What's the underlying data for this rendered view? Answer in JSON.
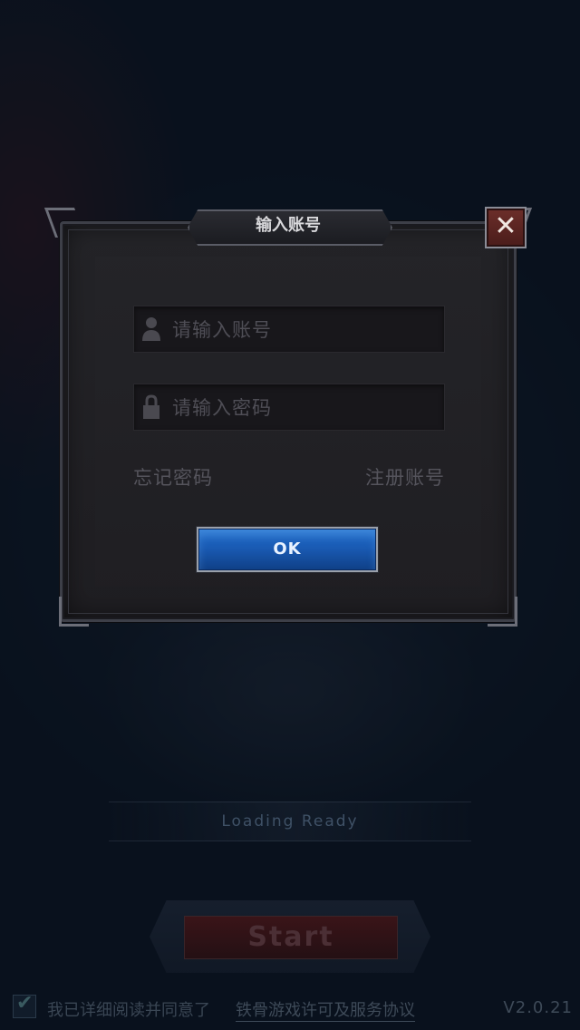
{
  "dialog": {
    "title": "输入账号",
    "close_icon": "✕",
    "account_placeholder": "请输入账号",
    "password_placeholder": "请输入密码",
    "forgot_password": "忘记密码",
    "register_account": "注册账号",
    "ok_button": "OK"
  },
  "background": {
    "loading_status": "Loading Ready",
    "start_button": "Start",
    "agreement_text": "我已详细阅读并同意了",
    "agreement_link": "铁骨游戏许可及服务协议",
    "checkmark": "✔",
    "version": "V2.0.21"
  },
  "colors": {
    "ok_button": "#1a5bb4",
    "close_button": "#5a2420",
    "background": "#0d1826"
  },
  "icons": {
    "user": "user-icon",
    "lock": "lock-icon",
    "close": "close-icon",
    "check": "checkmark-icon"
  }
}
